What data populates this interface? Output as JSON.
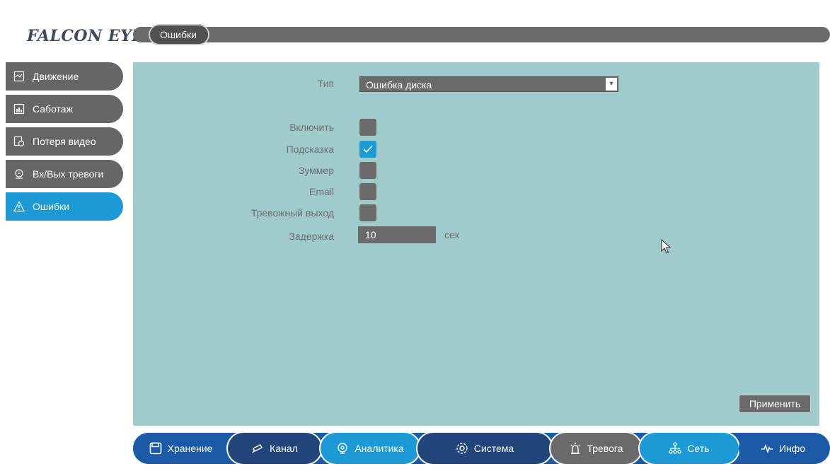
{
  "brand": {
    "logo_text": "FALCON EYE"
  },
  "header": {
    "active_tab": "Ошибки"
  },
  "sidebar": {
    "items": [
      {
        "label": "Движение",
        "icon": "motion-icon",
        "active": false
      },
      {
        "label": "Саботаж",
        "icon": "tamper-icon",
        "active": false
      },
      {
        "label": "Потеря видео",
        "icon": "video-loss-icon",
        "active": false
      },
      {
        "label": "Вх/Вых тревоги",
        "icon": "alarm-io-icon",
        "active": false
      },
      {
        "label": "Ошибки",
        "icon": "warning-icon",
        "active": true
      }
    ]
  },
  "form": {
    "type_label": "Тип",
    "type_value": "Ошибка диска",
    "enable_label": "Включить",
    "enable_checked": false,
    "hint_label": "Подсказка",
    "hint_checked": true,
    "buzzer_label": "Зуммер",
    "buzzer_checked": false,
    "email_label": "Email",
    "email_checked": false,
    "alarm_out_label": "Тревожный выход",
    "alarm_out_checked": false,
    "delay_label": "Задержка",
    "delay_value": "10",
    "delay_unit": "сек",
    "apply_label": "Применить"
  },
  "bottom_nav": {
    "items": [
      {
        "label": "Хранение",
        "icon": "save-icon"
      },
      {
        "label": "Канал",
        "icon": "camera-icon"
      },
      {
        "label": "Аналитика",
        "icon": "analytics-icon"
      },
      {
        "label": "Система",
        "icon": "gear-icon"
      },
      {
        "label": "Тревога",
        "icon": "alarm-icon"
      },
      {
        "label": "Сеть",
        "icon": "network-icon"
      },
      {
        "label": "Инфо",
        "icon": "pulse-icon"
      }
    ]
  },
  "colors": {
    "accent": "#1b9ad6",
    "panel": "#9fcbcb",
    "nav": "#1a5aa6",
    "control": "#6a6a6a"
  }
}
